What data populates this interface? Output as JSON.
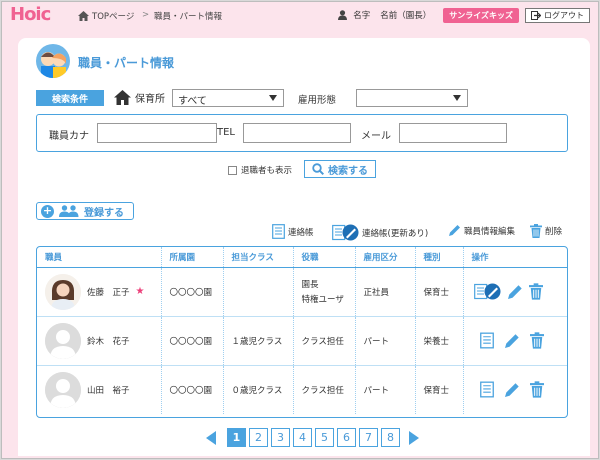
{
  "header": {
    "logo": "Hoic",
    "breadcrumb": {
      "home": "TOPページ",
      "separator": ">",
      "current": "職員・パート情報"
    },
    "user_label": "名字",
    "user_name": "名前（園長）",
    "facility": "サンライズキッズ",
    "logout": "ログアウト"
  },
  "page": {
    "title": "職員・パート情報"
  },
  "search": {
    "label": "検索条件",
    "nursery_label": "保育所",
    "nursery_value": "すべて",
    "employment_label": "雇用形態",
    "employment_value": "",
    "kana_label": "職員カナ",
    "kana_value": "",
    "tel_label": "TEL",
    "tel_value": "",
    "mail_label": "メール",
    "mail_value": "",
    "retired_label": "退職者も表示",
    "search_button": "検索する"
  },
  "actions": {
    "register": "登録する",
    "legend": [
      "連絡帳",
      "連絡帳(更新あり)",
      "職員情報編集",
      "削除"
    ]
  },
  "table": {
    "headers": [
      "職員",
      "所属園",
      "担当クラス",
      "役職",
      "雇用区分",
      "種別",
      "操作"
    ],
    "rows": [
      {
        "name": "佐藤　正子",
        "star": "★",
        "nursery": "〇〇〇〇園",
        "class": "",
        "role1": "園長",
        "role2": "特権ユーザ",
        "employment": "正社員",
        "type": "保育士",
        "updated": true
      },
      {
        "name": "鈴木　花子",
        "star": "",
        "nursery": "〇〇〇〇園",
        "class": "１歳児クラス",
        "role1": "クラス担任",
        "role2": "",
        "employment": "パート",
        "type": "栄養士",
        "updated": false
      },
      {
        "name": "山田　裕子",
        "star": "",
        "nursery": "〇〇〇〇園",
        "class": "０歳児クラス",
        "role1": "クラス担任",
        "role2": "",
        "employment": "パート",
        "type": "保育士",
        "updated": false
      }
    ]
  },
  "pagination": {
    "pages": [
      "1",
      "2",
      "3",
      "4",
      "5",
      "6",
      "7",
      "8"
    ],
    "current": "1"
  },
  "colors": {
    "accent": "#4aa3df",
    "pink": "#f06292",
    "background": "#fce4ec"
  }
}
